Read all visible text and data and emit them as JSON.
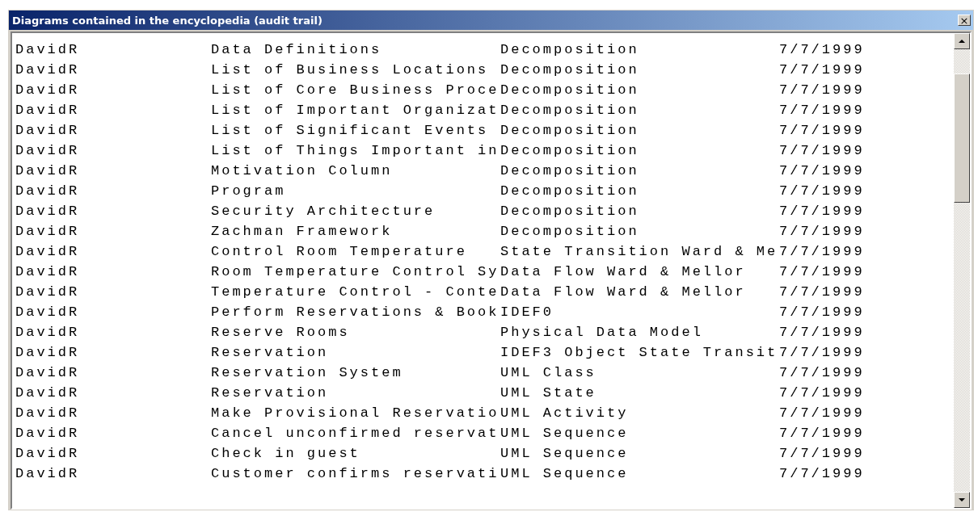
{
  "window": {
    "title": "Diagrams contained in the encyclopedia (audit trail)",
    "close": "×"
  },
  "rows": [
    [
      "DavidR",
      "Data Definitions",
      "Decomposition",
      "7/7/1999"
    ],
    [
      "DavidR",
      "List of Business Locations",
      "Decomposition",
      "7/7/1999"
    ],
    [
      "DavidR",
      "List of Core Business Proce",
      "Decomposition",
      "7/7/1999"
    ],
    [
      "DavidR",
      "List of Important Organizat",
      "Decomposition",
      "7/7/1999"
    ],
    [
      "DavidR",
      "List of Significant Events",
      "Decomposition",
      "7/7/1999"
    ],
    [
      "DavidR",
      "List of Things Important in",
      "Decomposition",
      "7/7/1999"
    ],
    [
      "DavidR",
      "Motivation Column",
      "Decomposition",
      "7/7/1999"
    ],
    [
      "DavidR",
      "Program",
      "Decomposition",
      "7/7/1999"
    ],
    [
      "DavidR",
      "Security Architecture",
      "Decomposition",
      "7/7/1999"
    ],
    [
      "DavidR",
      "Zachman Framework",
      "Decomposition",
      "7/7/1999"
    ],
    [
      "DavidR",
      "Control Room Temperature",
      "State Transition Ward & Me",
      "7/7/1999"
    ],
    [
      "DavidR",
      "Room Temperature Control Sy",
      "Data Flow Ward & Mellor",
      "7/7/1999"
    ],
    [
      "DavidR",
      "Temperature Control - Conte",
      "Data Flow Ward & Mellor",
      "7/7/1999"
    ],
    [
      "DavidR",
      "Perform Reservations & Book",
      "IDEF0",
      "7/7/1999"
    ],
    [
      "DavidR",
      "Reserve Rooms",
      "Physical Data Model",
      "7/7/1999"
    ],
    [
      "DavidR",
      "Reservation",
      "IDEF3 Object State Transit",
      "7/7/1999"
    ],
    [
      "DavidR",
      "Reservation System",
      "UML Class",
      "7/7/1999"
    ],
    [
      "DavidR",
      "Reservation",
      "UML State",
      "7/7/1999"
    ],
    [
      "DavidR",
      "Make Provisional Reservatio",
      "UML Activity",
      "7/7/1999"
    ],
    [
      "DavidR",
      "Cancel unconfirmed reservat",
      "UML Sequence",
      "7/7/1999"
    ],
    [
      "DavidR",
      "Check in guest",
      "UML Sequence",
      "7/7/1999"
    ],
    [
      "DavidR",
      "Customer confirms reservati",
      "UML Sequence",
      "7/7/1999"
    ]
  ]
}
